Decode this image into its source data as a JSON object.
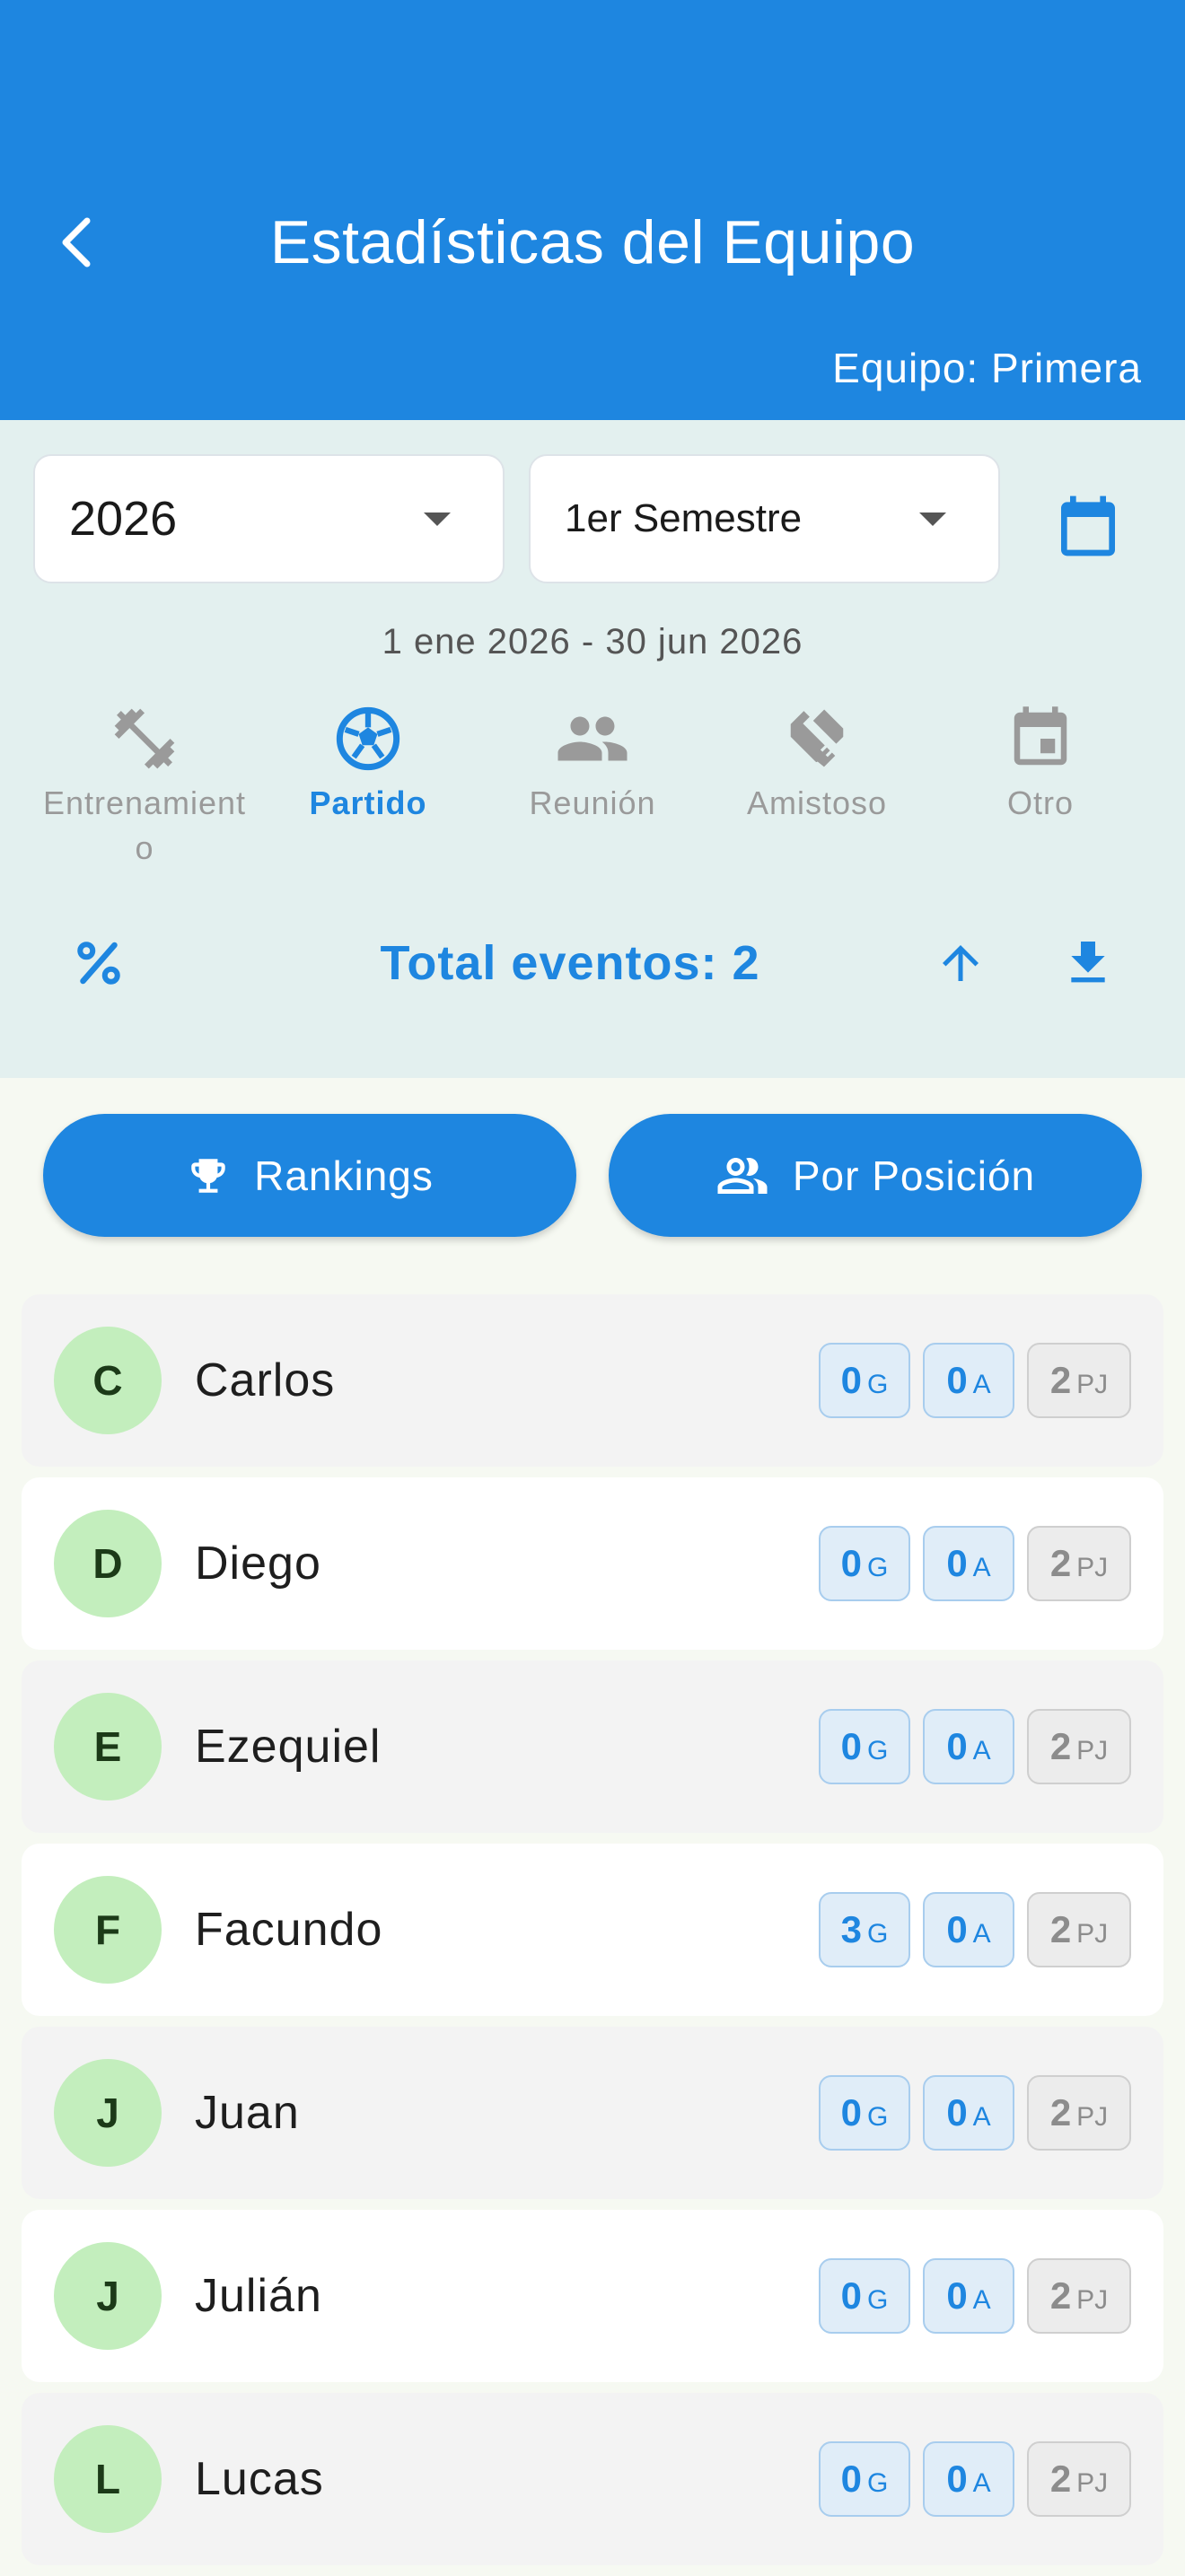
{
  "header": {
    "title": "Estadísticas del Equipo",
    "subtitle": "Equipo: Primera",
    "background": "#1e86e0"
  },
  "filters": {
    "year": "2026",
    "period": "1er Semestre",
    "date_range": "1 ene 2026 - 30 jun 2026",
    "event_types": [
      {
        "label": "Entrenamiento",
        "icon": "dumbbell-icon",
        "active": false
      },
      {
        "label": "Partido",
        "icon": "soccer-ball-icon",
        "active": true
      },
      {
        "label": "Reunión",
        "icon": "group-icon",
        "active": false
      },
      {
        "label": "Amistoso",
        "icon": "handshake-icon",
        "active": false
      },
      {
        "label": "Otro",
        "icon": "calendar-event-icon",
        "active": false
      }
    ],
    "total_events": "Total eventos: 2"
  },
  "actions": {
    "rankings": "Rankings",
    "by_position": "Por Posición"
  },
  "players": [
    {
      "initial": "C",
      "name": "Carlos",
      "goals": "0",
      "assists": "0",
      "played": "2"
    },
    {
      "initial": "D",
      "name": "Diego",
      "goals": "0",
      "assists": "0",
      "played": "2"
    },
    {
      "initial": "E",
      "name": "Ezequiel",
      "goals": "0",
      "assists": "0",
      "played": "2"
    },
    {
      "initial": "F",
      "name": "Facundo",
      "goals": "3",
      "assists": "0",
      "played": "2"
    },
    {
      "initial": "J",
      "name": "Juan",
      "goals": "0",
      "assists": "0",
      "played": "2"
    },
    {
      "initial": "J",
      "name": "Julián",
      "goals": "0",
      "assists": "0",
      "played": "2"
    },
    {
      "initial": "L",
      "name": "Lucas",
      "goals": "0",
      "assists": "0",
      "played": "2"
    }
  ],
  "units": {
    "goals": "G",
    "assists": "A",
    "played": "PJ"
  },
  "colors": {
    "accent": "#1e86e0",
    "avatar": "#c3eebd",
    "filter_bg": "#e3f0ef"
  }
}
